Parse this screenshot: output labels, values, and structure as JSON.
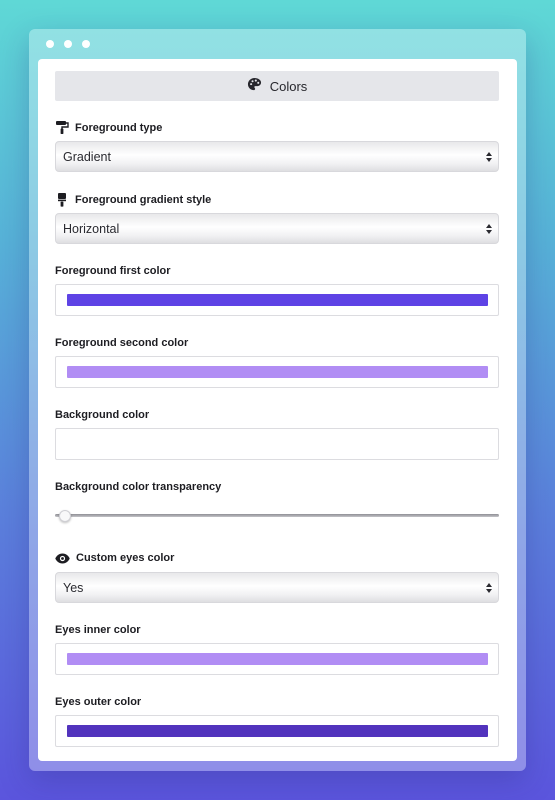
{
  "header": {
    "title": "Colors",
    "icon": "palette-icon"
  },
  "fields": {
    "foreground_type": {
      "label": "Foreground type",
      "value": "Gradient",
      "icon": "paint-roller-icon"
    },
    "gradient_style": {
      "label": "Foreground gradient style",
      "value": "Horizontal",
      "icon": "paint-brush-icon"
    },
    "first_color": {
      "label": "Foreground first color",
      "color": "#5e43e5"
    },
    "second_color": {
      "label": "Foreground second color",
      "color": "#b18df4"
    },
    "background_color": {
      "label": "Background color",
      "color": "#ffffff"
    },
    "transparency": {
      "label": "Background color transparency",
      "value_fraction": 0.0
    },
    "custom_eyes": {
      "label": "Custom eyes color",
      "value": "Yes",
      "icon": "eye-icon"
    },
    "eyes_inner": {
      "label": "Eyes inner color",
      "color": "#b18df4"
    },
    "eyes_outer": {
      "label": "Eyes outer color",
      "color": "#5233bd"
    }
  }
}
